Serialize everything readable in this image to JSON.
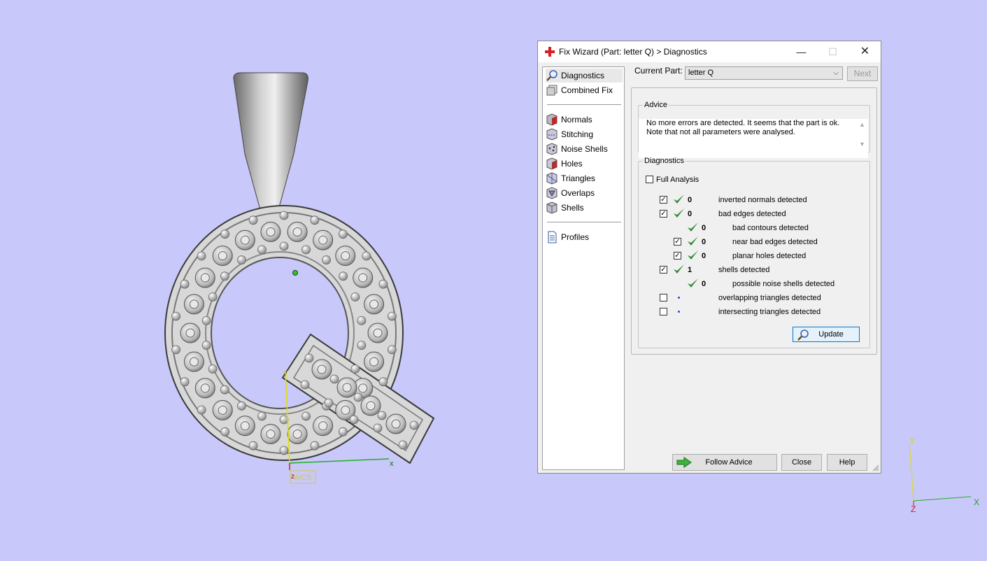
{
  "viewport": {
    "background": "#c8c8fa",
    "axis_x_label": "x",
    "axis_y_label": "y",
    "axis_z_label": "z",
    "wcs_label": "WCS",
    "corner_axes": {
      "x": "X",
      "y": "Y",
      "z": "Z"
    }
  },
  "dialog": {
    "title": "Fix Wizard (Part: letter Q) > Diagnostics",
    "nav": {
      "items": [
        {
          "label": "Diagnostics",
          "icon": "magnifier-icon",
          "selected": true
        },
        {
          "label": "Combined Fix",
          "icon": "combined-fix-icon"
        },
        {
          "label": "Normals",
          "icon": "normals-icon"
        },
        {
          "label": "Stitching",
          "icon": "stitching-icon"
        },
        {
          "label": "Noise Shells",
          "icon": "noise-shells-icon"
        },
        {
          "label": "Holes",
          "icon": "holes-icon"
        },
        {
          "label": "Triangles",
          "icon": "triangles-icon"
        },
        {
          "label": "Overlaps",
          "icon": "overlaps-icon"
        },
        {
          "label": "Shells",
          "icon": "shells-icon"
        },
        {
          "label": "Profiles",
          "icon": "document-icon"
        }
      ]
    },
    "current_part_label": "Current Part:",
    "current_part_value": "letter Q",
    "next_label": "Next",
    "advice": {
      "legend": "Advice",
      "line1": "No more errors are detected. It seems that the part is ok.",
      "line2": "Note that not all parameters were analysed."
    },
    "diagnostics": {
      "legend": "Diagnostics",
      "full_analysis_label": "Full Analysis",
      "full_analysis_checked": false,
      "rows": [
        {
          "checked": true,
          "status": "ok",
          "count": "0",
          "label": "inverted normals detected"
        },
        {
          "checked": true,
          "status": "ok",
          "count": "0",
          "label": "bad edges detected"
        },
        {
          "checked": null,
          "status": "ok",
          "count": "0",
          "label": "bad contours detected"
        },
        {
          "checked": true,
          "status": "ok",
          "count": "0",
          "label": "near bad edges detected"
        },
        {
          "checked": true,
          "status": "ok",
          "count": "0",
          "label": "planar holes detected"
        },
        {
          "checked": true,
          "status": "ok",
          "count": "1",
          "label": "shells detected"
        },
        {
          "checked": null,
          "status": "ok",
          "count": "0",
          "label": "possible noise shells detected"
        },
        {
          "checked": false,
          "status": "pending",
          "count": "",
          "label": "overlapping triangles detected"
        },
        {
          "checked": false,
          "status": "pending",
          "count": "",
          "label": "intersecting triangles detected"
        }
      ]
    },
    "update_label": "Update",
    "follow_advice_label": "Follow Advice",
    "close_label": "Close",
    "help_label": "Help",
    "colors": {
      "check": "#2f8a2f",
      "pending_dot": "#1f4fd0",
      "accent": "#0078d7"
    }
  }
}
